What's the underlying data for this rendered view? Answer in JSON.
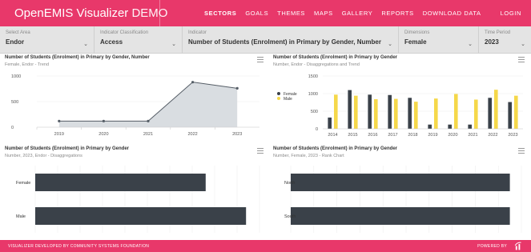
{
  "header": {
    "app_title": "OpenEMIS Visualizer",
    "app_suffix": "DEMO",
    "nav": [
      "SECTORS",
      "GOALS",
      "THEMES",
      "MAPS",
      "GALLERY",
      "REPORTS",
      "DOWNLOAD DATA"
    ],
    "active_nav": "SECTORS",
    "login": "LOGIN",
    "brand_color": "#e8386a"
  },
  "filters": {
    "area": {
      "label": "Select Area",
      "value": "Endor"
    },
    "classification": {
      "label": "Indicator Classification",
      "value": "Access"
    },
    "indicator": {
      "label": "Indicator",
      "value": "Number of Students (Enrolment) in Primary by Gender, Number"
    },
    "dimensions": {
      "label": "Dimensions",
      "value": "Female"
    },
    "period": {
      "label": "Time Period",
      "value": "2023"
    }
  },
  "panels": {
    "trend": {
      "title": "Number of Students (Enrolment) in Primary by Gender, Number",
      "subtitle": "Female, Endor - Trend"
    },
    "disagg_trend": {
      "title": "Number of Students (Enrolment) in Primary by Gender",
      "subtitle": "Number, Endor - Disaggregations and Trend"
    },
    "disagg": {
      "title": "Number of Students (Enrolment) in Primary by Gender",
      "subtitle": "Number, 2023, Endor - Disaggregations"
    },
    "rank": {
      "title": "Number of Students (Enrolment) in Primary by Gender",
      "subtitle": "Number, Female, 2023 - Rank Chart"
    }
  },
  "footer": {
    "left": "VISUALIZER DEVELOPED BY COMMUNITY SYSTEMS FOUNDATION",
    "right": "POWERED BY"
  },
  "chart_data": [
    {
      "type": "area",
      "x": [
        "2019",
        "2020",
        "2021",
        "2022",
        "2023"
      ],
      "values": [
        120,
        120,
        120,
        880,
        760
      ],
      "ylim": [
        0,
        1000
      ],
      "yticks": [
        0,
        500,
        1000
      ],
      "color": "#555d66",
      "fill": "#d9dde1"
    },
    {
      "type": "bar",
      "categories": [
        "2014",
        "2015",
        "2016",
        "2017",
        "2018",
        "2019",
        "2020",
        "2021",
        "2022",
        "2023"
      ],
      "series": [
        {
          "name": "Female",
          "color": "#3a4149",
          "values": [
            320,
            1100,
            970,
            960,
            880,
            120,
            120,
            120,
            880,
            760
          ]
        },
        {
          "name": "Male",
          "color": "#f5d84a",
          "values": [
            970,
            940,
            840,
            850,
            770,
            860,
            990,
            830,
            1110,
            940
          ]
        }
      ],
      "ylim": [
        0,
        1500
      ],
      "yticks": [
        0,
        500,
        1000,
        1500
      ],
      "legend": "left"
    },
    {
      "type": "bar",
      "orientation": "horizontal",
      "categories": [
        "Female",
        "Male"
      ],
      "values": [
        760,
        940
      ],
      "xlim": [
        0,
        1000
      ],
      "color": "#3a4149"
    },
    {
      "type": "bar",
      "orientation": "horizontal",
      "categories": [
        "North",
        "South"
      ],
      "values": [
        760,
        760
      ],
      "xlim": [
        0,
        800
      ],
      "color": "#3a4149"
    }
  ]
}
